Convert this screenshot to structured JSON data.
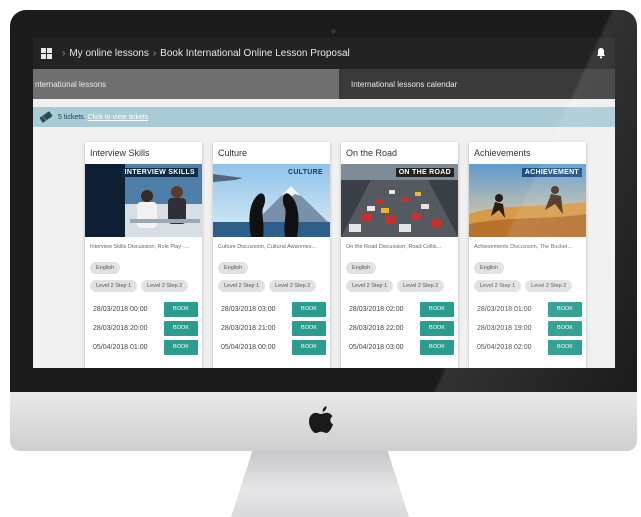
{
  "header": {
    "crumbs": [
      "My online lessons",
      "Book International Online Lesson Proposal"
    ],
    "separator": "›"
  },
  "tabs": [
    {
      "label": "nternational lessons"
    },
    {
      "label": "International lessons calendar"
    }
  ],
  "tickets": {
    "count_text": "5 tickets.",
    "link": "Click to view tickets"
  },
  "cards": [
    {
      "title": "Interview Skills",
      "banner": "INTERVIEW SKILLS",
      "description": "Interview Skills Discussion, Role Play -...",
      "language": "English",
      "levels": [
        "Level 2 Step 1",
        "Level 2 Step 2"
      ],
      "slots": [
        {
          "datetime": "28/03/2018 00:00",
          "button": "BOOK"
        },
        {
          "datetime": "28/03/2018 20:00",
          "button": "BOOK"
        },
        {
          "datetime": "05/04/2018 01:00",
          "button": "BOOK"
        }
      ]
    },
    {
      "title": "Culture",
      "banner": "CULTURE",
      "description": "Culture Discussion, Cultural Awarenes...",
      "language": "English",
      "levels": [
        "Level 2 Step 1",
        "Level 2 Step 2"
      ],
      "slots": [
        {
          "datetime": "28/03/2018 03:00",
          "button": "BOOK"
        },
        {
          "datetime": "28/03/2018 21:00",
          "button": "BOOK"
        },
        {
          "datetime": "05/04/2018 00:00",
          "button": "BOOK"
        }
      ]
    },
    {
      "title": "On the Road",
      "banner": "ON THE ROAD",
      "description": "On the Road Discussion, Road Collis...",
      "language": "English",
      "levels": [
        "Level 2 Step 1",
        "Level 2 Step 2"
      ],
      "slots": [
        {
          "datetime": "28/03/2018 02:00",
          "button": "BOOK"
        },
        {
          "datetime": "28/03/2018 22:00",
          "button": "BOOK"
        },
        {
          "datetime": "05/04/2018 03:00",
          "button": "BOOK"
        }
      ]
    },
    {
      "title": "Achievements",
      "banner": "ACHIEVEMENT",
      "description": "Achievements Discussion, The Bucket...",
      "language": "English",
      "levels": [
        "Level 2 Step 1",
        "Level 2 Step 2"
      ],
      "slots": [
        {
          "datetime": "28/03/2018 01:00",
          "button": "BOOK"
        },
        {
          "datetime": "28/03/2018 19:00",
          "button": "BOOK"
        },
        {
          "datetime": "05/04/2018 02:00",
          "button": "BOOK"
        }
      ]
    }
  ],
  "colors": {
    "topbar": "#232323",
    "active_tab": "#707070",
    "tickets_bar": "#a9cbd5",
    "book_button": "#2a9d8f"
  },
  "icons": [
    "apps-grid-icon",
    "bell-icon",
    "ticket-icon",
    "apple-logo-icon"
  ]
}
